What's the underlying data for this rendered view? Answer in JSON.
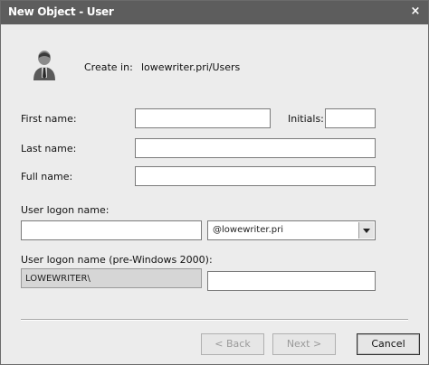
{
  "window": {
    "title": "New Object - User",
    "close_glyph": "×"
  },
  "header": {
    "icon": "user-icon",
    "create_in_label": "Create in:",
    "create_in_value": "lowewriter.pri/Users"
  },
  "form": {
    "first_name_label": "First name:",
    "first_name_value": "",
    "initials_label": "Initials:",
    "initials_value": "",
    "last_name_label": "Last name:",
    "last_name_value": "",
    "full_name_label": "Full name:",
    "full_name_value": "",
    "logon_name_label": "User logon name:",
    "logon_name_value": "",
    "domain_select_value": "@lowewriter.pri",
    "pre2000_label": "User logon name (pre-Windows 2000):",
    "pre2000_domain_value": "LOWEWRITER\\",
    "pre2000_name_value": ""
  },
  "buttons": {
    "back": "< Back",
    "next": "Next >",
    "cancel": "Cancel"
  },
  "colors": {
    "titlebar": "#5d5d5d",
    "dialog_bg": "#ececec"
  }
}
